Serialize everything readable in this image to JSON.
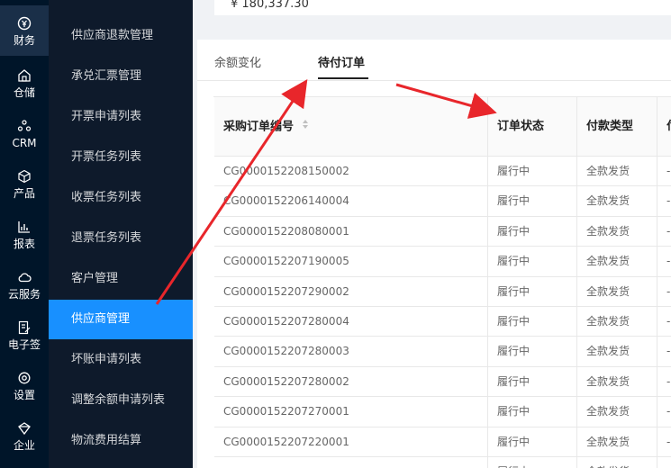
{
  "nav_rail": [
    {
      "label": "财务",
      "icon": "finance-icon",
      "active": true
    },
    {
      "label": "仓储",
      "icon": "warehouse-icon"
    },
    {
      "label": "CRM",
      "icon": "crm-icon"
    },
    {
      "label": "产品",
      "icon": "product-icon"
    },
    {
      "label": "报表",
      "icon": "report-icon"
    },
    {
      "label": "云服务",
      "icon": "cloud-icon"
    },
    {
      "label": "电子签",
      "icon": "esign-icon"
    },
    {
      "label": "设置",
      "icon": "settings-icon"
    },
    {
      "label": "企业",
      "icon": "enterprise-icon"
    }
  ],
  "submenu": [
    {
      "label": "供应商退款管理"
    },
    {
      "label": "承兑汇票管理"
    },
    {
      "label": "开票申请列表"
    },
    {
      "label": "开票任务列表"
    },
    {
      "label": "收票任务列表"
    },
    {
      "label": "退票任务列表"
    },
    {
      "label": "客户管理"
    },
    {
      "label": "供应商管理",
      "active": true
    },
    {
      "label": "坏账申请列表"
    },
    {
      "label": "调整余额申请列表"
    },
    {
      "label": "物流费用结算"
    }
  ],
  "top_card": {
    "amount": "¥ 180,337.30"
  },
  "tabs": [
    {
      "label": "余额变化"
    },
    {
      "label": "待付订单",
      "active": true
    }
  ],
  "table": {
    "columns": [
      "采购订单编号",
      "订单状态",
      "付款类型",
      "付"
    ],
    "rows": [
      [
        "CG0000152208150002",
        "履行中",
        "全款发货",
        "-"
      ],
      [
        "CG0000152206140004",
        "履行中",
        "全款发货",
        "-"
      ],
      [
        "CG0000152208080001",
        "履行中",
        "全款发货",
        "-"
      ],
      [
        "CG0000152207190005",
        "履行中",
        "全款发货",
        "-"
      ],
      [
        "CG0000152207290002",
        "履行中",
        "全款发货",
        "-"
      ],
      [
        "CG0000152207280004",
        "履行中",
        "全款发货",
        "-"
      ],
      [
        "CG0000152207280003",
        "履行中",
        "全款发货",
        "-"
      ],
      [
        "CG0000152207280002",
        "履行中",
        "全款发货",
        "-"
      ],
      [
        "CG0000152207270001",
        "履行中",
        "全款发货",
        "-"
      ],
      [
        "CG0000152207220001",
        "履行中",
        "全款发货",
        "-"
      ],
      [
        "",
        "履行中",
        "全款发货",
        ""
      ]
    ]
  },
  "colors": {
    "accent": "#1890ff",
    "rail_bg": "#001529",
    "submenu_bg": "#0e1a2b",
    "annotation": "#e8262b"
  }
}
